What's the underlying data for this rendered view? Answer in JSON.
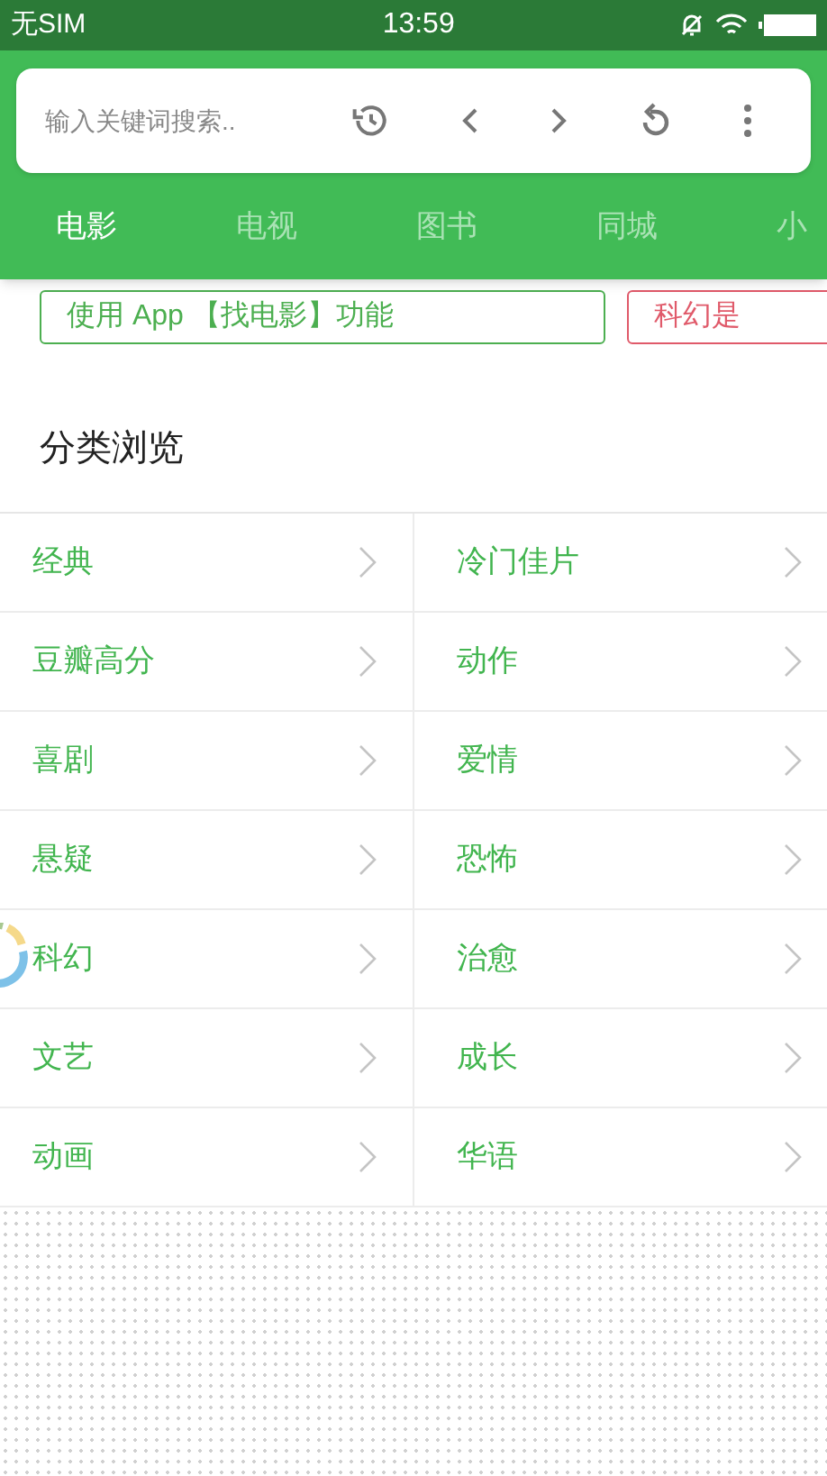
{
  "status_bar": {
    "carrier": "无SIM",
    "time": "13:59"
  },
  "search": {
    "placeholder": "输入关键词搜索.."
  },
  "tabs": [
    {
      "label": "电影",
      "selected": true
    },
    {
      "label": "电视",
      "selected": false
    },
    {
      "label": "图书",
      "selected": false
    },
    {
      "label": "同城",
      "selected": false
    },
    {
      "label": "小",
      "selected": false
    }
  ],
  "banners": [
    {
      "text": "使用 App 【找电影】功能",
      "color": "#4caf50"
    },
    {
      "text": "科幻是",
      "color": "#e05a6a"
    }
  ],
  "section_title": "分类浏览",
  "categories": [
    {
      "label": "经典"
    },
    {
      "label": "冷门佳片"
    },
    {
      "label": "豆瓣高分"
    },
    {
      "label": "动作"
    },
    {
      "label": "喜剧"
    },
    {
      "label": "爱情"
    },
    {
      "label": "悬疑"
    },
    {
      "label": "恐怖"
    },
    {
      "label": "科幻"
    },
    {
      "label": "治愈"
    },
    {
      "label": "文艺"
    },
    {
      "label": "成长"
    },
    {
      "label": "动画"
    },
    {
      "label": "华语"
    }
  ]
}
